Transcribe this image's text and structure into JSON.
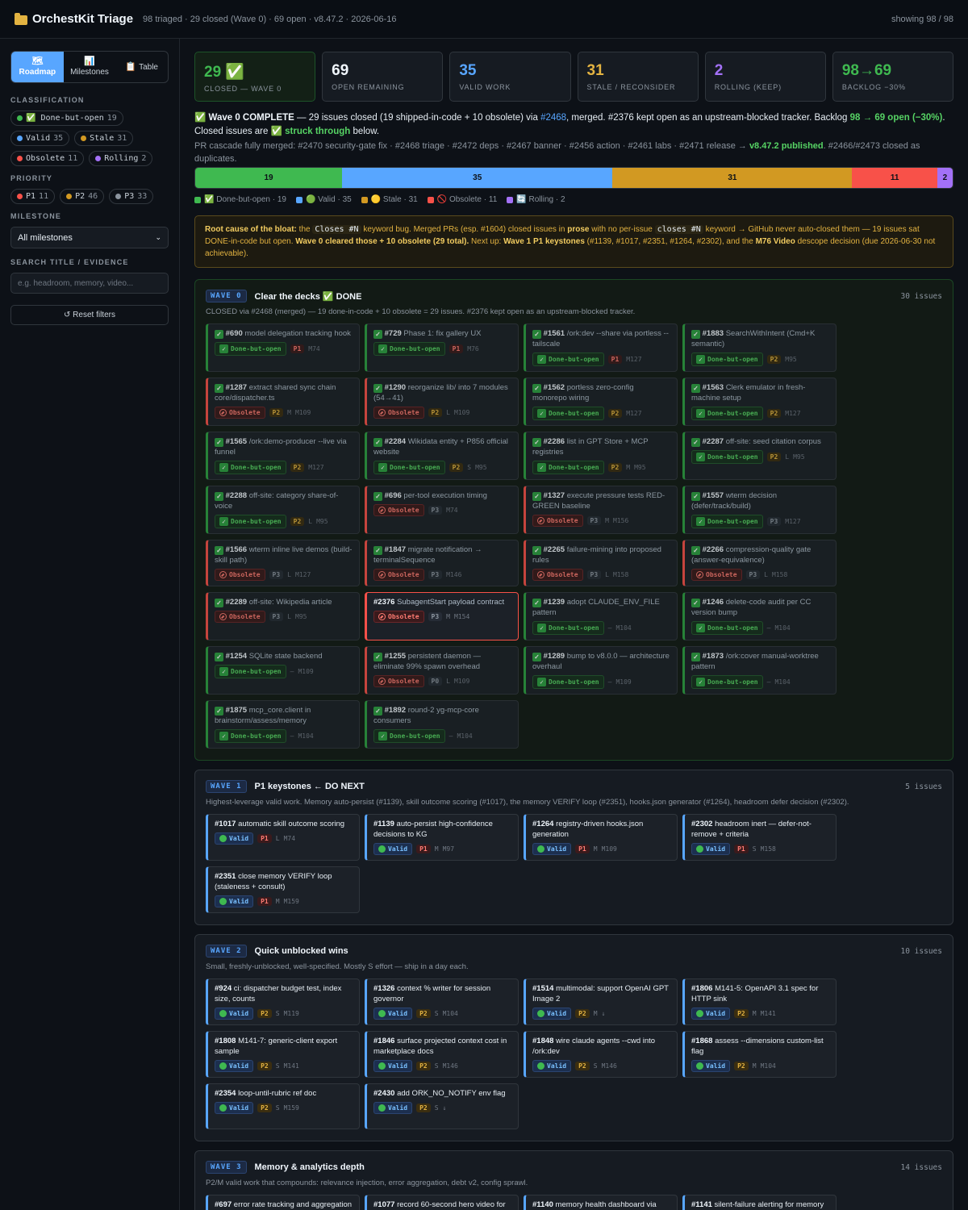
{
  "header": {
    "title": "OrchestKit Triage",
    "meta": "98 triaged · 29 closed (Wave 0) · 69 open · v8.47.2 · 2026-06-16",
    "showing": "showing 98 / 98"
  },
  "sidebar": {
    "tabs": [
      {
        "label": "Roadmap",
        "icon": "🗺"
      },
      {
        "label": "Milestones",
        "icon": "📊"
      },
      {
        "label": "Table",
        "icon": "📋"
      }
    ],
    "classification_title": "CLASSIFICATION",
    "classification": [
      {
        "label": "✅ Done-but-open",
        "count": "19",
        "color": "#3fb950"
      },
      {
        "label": "Valid",
        "count": "35",
        "color": "#58a6ff"
      },
      {
        "label": "Stale",
        "count": "31",
        "color": "#d29922"
      },
      {
        "label": "Obsolete",
        "count": "11",
        "color": "#f85149"
      },
      {
        "label": "Rolling",
        "count": "2",
        "color": "#a371f7"
      }
    ],
    "priority_title": "PRIORITY",
    "priority": [
      {
        "label": "P1",
        "count": "11",
        "color": "#f85149"
      },
      {
        "label": "P2",
        "count": "46",
        "color": "#d29922"
      },
      {
        "label": "P3",
        "count": "33",
        "color": "#8b949e"
      }
    ],
    "milestone_title": "MILESTONE",
    "milestone_value": "All milestones",
    "search_title": "SEARCH TITLE / EVIDENCE",
    "search_placeholder": "e.g. headroom, memory, video...",
    "reset": "↺ Reset filters"
  },
  "stats": [
    {
      "value": "29 ✅",
      "label": "CLOSED — WAVE 0",
      "color": "#3fb950"
    },
    {
      "value": "69",
      "label": "OPEN REMAINING",
      "color": "#f0f6fc"
    },
    {
      "value": "35",
      "label": "VALID WORK",
      "color": "#58a6ff"
    },
    {
      "value": "31",
      "label": "STALE / RECONSIDER",
      "color": "#e3b341"
    },
    {
      "value": "2",
      "label": "ROLLING (KEEP)",
      "color": "#a371f7"
    },
    {
      "value": "98→69",
      "label": "BACKLOG −30%",
      "color": "#3fb950"
    }
  ],
  "complete": {
    "lead": "✅ Wave 0 COMPLETE",
    "text1": " — 29 issues closed (19 shipped-in-code + 10 obsolete) via ",
    "link": "#2468",
    "text2": ", merged. #2376 kept open as an upstream-blocked tracker. Backlog ",
    "backlog": "98 → 69 open (−30%)",
    "text3": ". Closed issues are ",
    "struck": "✅ struck through",
    "text4": " below.",
    "cascade1": "PR cascade fully merged: #2470 security-gate fix · #2468 triage · #2472 deps · #2467 banner · #2456 action · #2461 labs · #2471 release → ",
    "cascade_pub": "v8.47.2 published",
    "cascade2": ". #2466/#2473 closed as duplicates."
  },
  "distribution": [
    {
      "label": "19",
      "value": 19,
      "color": "#3fb950"
    },
    {
      "label": "35",
      "value": 35,
      "color": "#58a6ff"
    },
    {
      "label": "31",
      "value": 31,
      "color": "#d29922"
    },
    {
      "label": "11",
      "value": 11,
      "color": "#f85149"
    },
    {
      "label": "2",
      "value": 2,
      "color": "#a371f7"
    }
  ],
  "legend": [
    {
      "label": "✅ Done-but-open · 19",
      "color": "#3fb950"
    },
    {
      "label": "🟢 Valid · 35",
      "color": "#58a6ff"
    },
    {
      "label": "🟡 Stale · 31",
      "color": "#d29922"
    },
    {
      "label": "🚫 Obsolete · 11",
      "color": "#f85149"
    },
    {
      "label": "🔄 Rolling · 2",
      "color": "#a371f7"
    }
  ],
  "root": {
    "lead": "Root cause of the bloat:",
    "a": " the ",
    "code1": "Closes #N",
    "b": " keyword bug. Merged PRs (esp. #1604) closed issues in ",
    "prose": "prose",
    "c": " with no per-issue ",
    "code2": "closes #N",
    "d": " keyword → GitHub never auto-closed them — 19 issues sat DONE-in-code but open. ",
    "bold1": "Wave 0 cleared those + 10 obsolete (29 total).",
    "e": " Next up: ",
    "bold2": "Wave 1 P1 keystones",
    "f": " (#1139, #1017, #2351, #1264, #2302), and the ",
    "bold3": "M76 Video",
    "g": " descope decision (due 2026-06-30 not achievable)."
  },
  "waves": [
    {
      "tag": "WAVE 0",
      "title": "Clear the decks ✅ DONE",
      "count": "30 issues",
      "desc": "CLOSED via #2468 (merged) — 19 done-in-code + 10 obsolete = 29 issues. #2376 kept open as an upstream-blocked tracker.",
      "kind": "w0",
      "cards": [
        {
          "num": "#690",
          "title": "model delegation tracking hook",
          "status": "Done-but-open",
          "st": "done",
          "pri": "P1",
          "size": "",
          "ms": "M74"
        },
        {
          "num": "#729",
          "title": "Phase 1: fix gallery UX",
          "status": "Done-but-open",
          "st": "done",
          "pri": "P1",
          "size": "",
          "ms": "M76"
        },
        {
          "num": "#1561",
          "title": "/ork:dev --share via portless --tailscale",
          "status": "Done-but-open",
          "st": "done",
          "pri": "P1",
          "size": "",
          "ms": "M127"
        },
        {
          "num": "#1883",
          "title": "SearchWithIntent (Cmd+K semantic)",
          "status": "Done-but-open",
          "st": "done",
          "pri": "P2",
          "size": "",
          "ms": "M95"
        },
        {
          "num": "#1287",
          "title": "extract shared sync chain core/dispatcher.ts",
          "status": "Obsolete",
          "st": "obs",
          "pri": "P2",
          "size": "M",
          "ms": "M109"
        },
        {
          "num": "#1290",
          "title": "reorganize lib/ into 7 modules (54→41)",
          "status": "Obsolete",
          "st": "obs",
          "pri": "P2",
          "size": "L",
          "ms": "M109"
        },
        {
          "num": "#1562",
          "title": "portless zero-config monorepo wiring",
          "status": "Done-but-open",
          "st": "done",
          "pri": "P2",
          "size": "",
          "ms": "M127"
        },
        {
          "num": "#1563",
          "title": "Clerk emulator in fresh-machine setup",
          "status": "Done-but-open",
          "st": "done",
          "pri": "P2",
          "size": "",
          "ms": "M127"
        },
        {
          "num": "#1565",
          "title": "/ork:demo-producer --live via funnel",
          "status": "Done-but-open",
          "st": "done",
          "pri": "P2",
          "size": "",
          "ms": "M127"
        },
        {
          "num": "#2284",
          "title": "Wikidata entity + P856 official website",
          "status": "Done-but-open",
          "st": "done",
          "pri": "P2",
          "size": "S",
          "ms": "M95"
        },
        {
          "num": "#2286",
          "title": "list in GPT Store + MCP registries",
          "status": "Done-but-open",
          "st": "done",
          "pri": "P2",
          "size": "M",
          "ms": "M95"
        },
        {
          "num": "#2287",
          "title": "off-site: seed citation corpus",
          "status": "Done-but-open",
          "st": "done",
          "pri": "P2",
          "size": "L",
          "ms": "M95"
        },
        {
          "num": "#2288",
          "title": "off-site: category share-of-voice",
          "status": "Done-but-open",
          "st": "done",
          "pri": "P2",
          "size": "L",
          "ms": "M95"
        },
        {
          "num": "#696",
          "title": "per-tool execution timing",
          "status": "Obsolete",
          "st": "obs",
          "pri": "P3",
          "size": "",
          "ms": "M74"
        },
        {
          "num": "#1327",
          "title": "execute pressure tests RED-GREEN baseline",
          "status": "Obsolete",
          "st": "obs",
          "pri": "P3",
          "size": "M",
          "ms": "M156"
        },
        {
          "num": "#1557",
          "title": "wterm decision (defer/track/build)",
          "status": "Done-but-open",
          "st": "done",
          "pri": "P3",
          "size": "",
          "ms": "M127"
        },
        {
          "num": "#1566",
          "title": "wterm inline live demos (build-skill path)",
          "status": "Obsolete",
          "st": "obs",
          "pri": "P3",
          "size": "L",
          "ms": "M127"
        },
        {
          "num": "#1847",
          "title": "migrate notification → terminalSequence",
          "status": "Obsolete",
          "st": "obs",
          "pri": "P3",
          "size": "",
          "ms": "M146"
        },
        {
          "num": "#2265",
          "title": "failure-mining into proposed rules",
          "status": "Obsolete",
          "st": "obs",
          "pri": "P3",
          "size": "L",
          "ms": "M158"
        },
        {
          "num": "#2266",
          "title": "compression-quality gate (answer-equivalence)",
          "status": "Obsolete",
          "st": "obs",
          "pri": "P3",
          "size": "L",
          "ms": "M158"
        },
        {
          "num": "#2289",
          "title": "off-site: Wikipedia article",
          "status": "Obsolete",
          "st": "obs",
          "pri": "P3",
          "size": "L",
          "ms": "M95"
        },
        {
          "num": "#2376",
          "title": "SubagentStart payload contract",
          "status": "Obsolete",
          "st": "obs hl",
          "pri": "P3",
          "size": "M",
          "ms": "M154"
        },
        {
          "num": "#1239",
          "title": "adopt CLAUDE_ENV_FILE pattern",
          "status": "Done-but-open",
          "st": "done",
          "pri": "—",
          "size": "",
          "ms": "M104"
        },
        {
          "num": "#1246",
          "title": "delete-code audit per CC version bump",
          "status": "Done-but-open",
          "st": "done",
          "pri": "—",
          "size": "",
          "ms": "M104"
        },
        {
          "num": "#1254",
          "title": "SQLite state backend",
          "status": "Done-but-open",
          "st": "done",
          "pri": "—",
          "size": "",
          "ms": "M109"
        },
        {
          "num": "#1255",
          "title": "persistent daemon — eliminate 99% spawn overhead",
          "status": "Obsolete",
          "st": "obs",
          "pri": "P0",
          "size": "L",
          "ms": "M109"
        },
        {
          "num": "#1289",
          "title": "bump to v8.0.0 — architecture overhaul",
          "status": "Done-but-open",
          "st": "done",
          "pri": "—",
          "size": "",
          "ms": "M109"
        },
        {
          "num": "#1873",
          "title": "/ork:cover manual-worktree pattern",
          "status": "Done-but-open",
          "st": "done",
          "pri": "—",
          "size": "",
          "ms": "M104"
        },
        {
          "num": "#1875",
          "title": "mcp_core.client in brainstorm/assess/memory",
          "status": "Done-but-open",
          "st": "done",
          "pri": "—",
          "size": "",
          "ms": "M104"
        },
        {
          "num": "#1892",
          "title": "round-2 yg-mcp-core consumers",
          "status": "Done-but-open",
          "st": "done",
          "pri": "—",
          "size": "",
          "ms": "M104"
        }
      ]
    },
    {
      "tag": "WAVE 1",
      "title": "P1 keystones ← DO NEXT",
      "count": "5 issues",
      "desc": "Highest-leverage valid work. Memory auto-persist (#1139), skill outcome scoring (#1017), the memory VERIFY loop (#2351), hooks.json generator (#1264), headroom defer decision (#2302).",
      "kind": "",
      "cards": [
        {
          "num": "#1017",
          "title": "automatic skill outcome scoring",
          "status": "Valid",
          "st": "valid",
          "pri": "P1",
          "size": "L",
          "ms": "M74"
        },
        {
          "num": "#1139",
          "title": "auto-persist high-confidence decisions to KG",
          "status": "Valid",
          "st": "valid",
          "pri": "P1",
          "size": "M",
          "ms": "M97"
        },
        {
          "num": "#1264",
          "title": "registry-driven hooks.json generation",
          "status": "Valid",
          "st": "valid",
          "pri": "P1",
          "size": "M",
          "ms": "M109"
        },
        {
          "num": "#2302",
          "title": "headroom inert — defer-not-remove + criteria",
          "status": "Valid",
          "st": "valid",
          "pri": "P1",
          "size": "S",
          "ms": "M158"
        },
        {
          "num": "#2351",
          "title": "close memory VERIFY loop (staleness + consult)",
          "status": "Valid",
          "st": "valid",
          "pri": "P1",
          "size": "M",
          "ms": "M159"
        }
      ]
    },
    {
      "tag": "WAVE 2",
      "title": "Quick unblocked wins",
      "count": "10 issues",
      "desc": "Small, freshly-unblocked, well-specified. Mostly S effort — ship in a day each.",
      "kind": "",
      "cards": [
        {
          "num": "#924",
          "title": "ci: dispatcher budget test, index size, counts",
          "status": "Valid",
          "st": "valid",
          "pri": "P2",
          "size": "S",
          "ms": "M119"
        },
        {
          "num": "#1326",
          "title": "context % writer for session governor",
          "status": "Valid",
          "st": "valid",
          "pri": "P2",
          "size": "S",
          "ms": "M104"
        },
        {
          "num": "#1514",
          "title": "multimodal: support OpenAI GPT Image 2",
          "status": "Valid",
          "st": "valid",
          "pri": "P2",
          "size": "M",
          "ms": "↓"
        },
        {
          "num": "#1806",
          "title": "M141-5: OpenAPI 3.1 spec for HTTP sink",
          "status": "Valid",
          "st": "valid",
          "pri": "P2",
          "size": "M",
          "ms": "M141"
        },
        {
          "num": "#1808",
          "title": "M141-7: generic-client export sample",
          "status": "Valid",
          "st": "valid",
          "pri": "P2",
          "size": "S",
          "ms": "M141"
        },
        {
          "num": "#1846",
          "title": "surface projected context cost in marketplace docs",
          "status": "Valid",
          "st": "valid",
          "pri": "P2",
          "size": "S",
          "ms": "M146"
        },
        {
          "num": "#1848",
          "title": "wire claude agents --cwd into /ork:dev",
          "status": "Valid",
          "st": "valid",
          "pri": "P2",
          "size": "S",
          "ms": "M146"
        },
        {
          "num": "#1868",
          "title": "assess --dimensions custom-list flag",
          "status": "Valid",
          "st": "valid",
          "pri": "P2",
          "size": "M",
          "ms": "M104"
        },
        {
          "num": "#2354",
          "title": "loop-until-rubric ref doc",
          "status": "Valid",
          "st": "valid",
          "pri": "P2",
          "size": "S",
          "ms": "M159"
        },
        {
          "num": "#2430",
          "title": "add ORK_NO_NOTIFY env flag",
          "status": "Valid",
          "st": "valid",
          "pri": "P2",
          "size": "S",
          "ms": "↓"
        }
      ]
    },
    {
      "tag": "WAVE 3",
      "title": "Memory & analytics depth",
      "count": "14 issues",
      "desc": "P2/M valid work that compounds: relevance injection, error aggregation, debt v2, config sprawl.",
      "kind": "",
      "cards": [
        {
          "num": "#697",
          "title": "error rate tracking and aggregation",
          "status": "Valid",
          "st": "valid",
          "pri": "P2",
          "size": "M",
          "ms": "M74"
        },
        {
          "num": "#1077",
          "title": "record 60-second hero video for homepage",
          "status": "Valid",
          "st": "valid",
          "pri": "P2",
          "size": "M",
          "ms": "M95"
        },
        {
          "num": "#1140",
          "title": "memory health dashboard via /ork:memory status",
          "status": "Valid",
          "st": "valid",
          "pri": "P2",
          "size": "M",
          "ms": "M97"
        },
        {
          "num": "#1141",
          "title": "silent-failure alerting for memory hooks",
          "status": "Valid",
          "st": "valid",
          "pri": "P2",
          "size": "M",
          "ms": "M97"
        }
      ]
    }
  ]
}
